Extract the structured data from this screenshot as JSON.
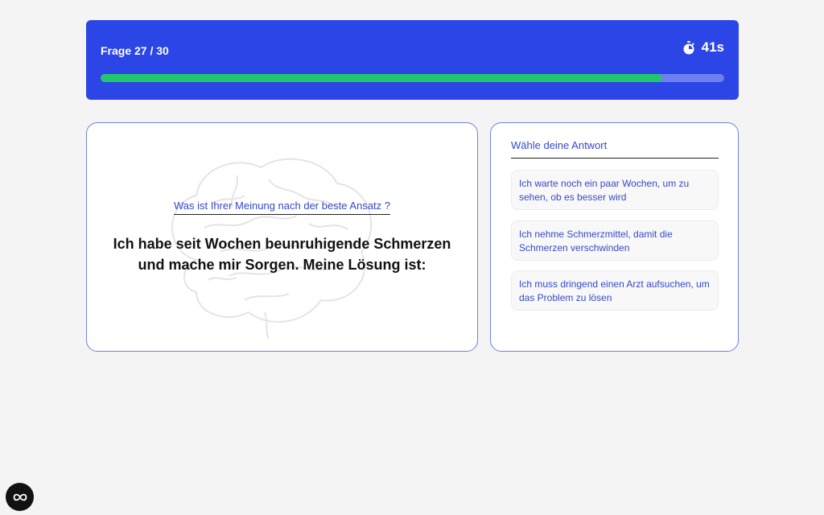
{
  "header": {
    "question_counter": "Frage 27 / 30",
    "timer": "41s",
    "timer_icon": "stopwatch-icon",
    "progress_fraction": 0.9
  },
  "question": {
    "subtitle": "Was ist Ihrer Meinung nach der beste Ansatz ?",
    "text": "Ich habe seit Wochen beunruhigende Schmerzen und mache mir Sorgen. Meine Lösung ist:",
    "background_image": "brain-illustration"
  },
  "answers": {
    "heading": "Wähle deine Antwort",
    "options": [
      "Ich warte noch ein paar Wochen, um zu sehen, ob es besser wird",
      "Ich nehme Schmerzmittel, damit die Schmerzen verschwinden",
      "Ich muss dringend einen Arzt aufsuchen, um das Problem zu lösen"
    ]
  },
  "colors": {
    "header_bg": "#2c45e6",
    "progress_fill": "#22c76c",
    "progress_track": "#6f7ef0",
    "accent_text": "#3549c9",
    "card_border": "#6d83dc"
  },
  "widget_icon": "infinity-logo-icon"
}
